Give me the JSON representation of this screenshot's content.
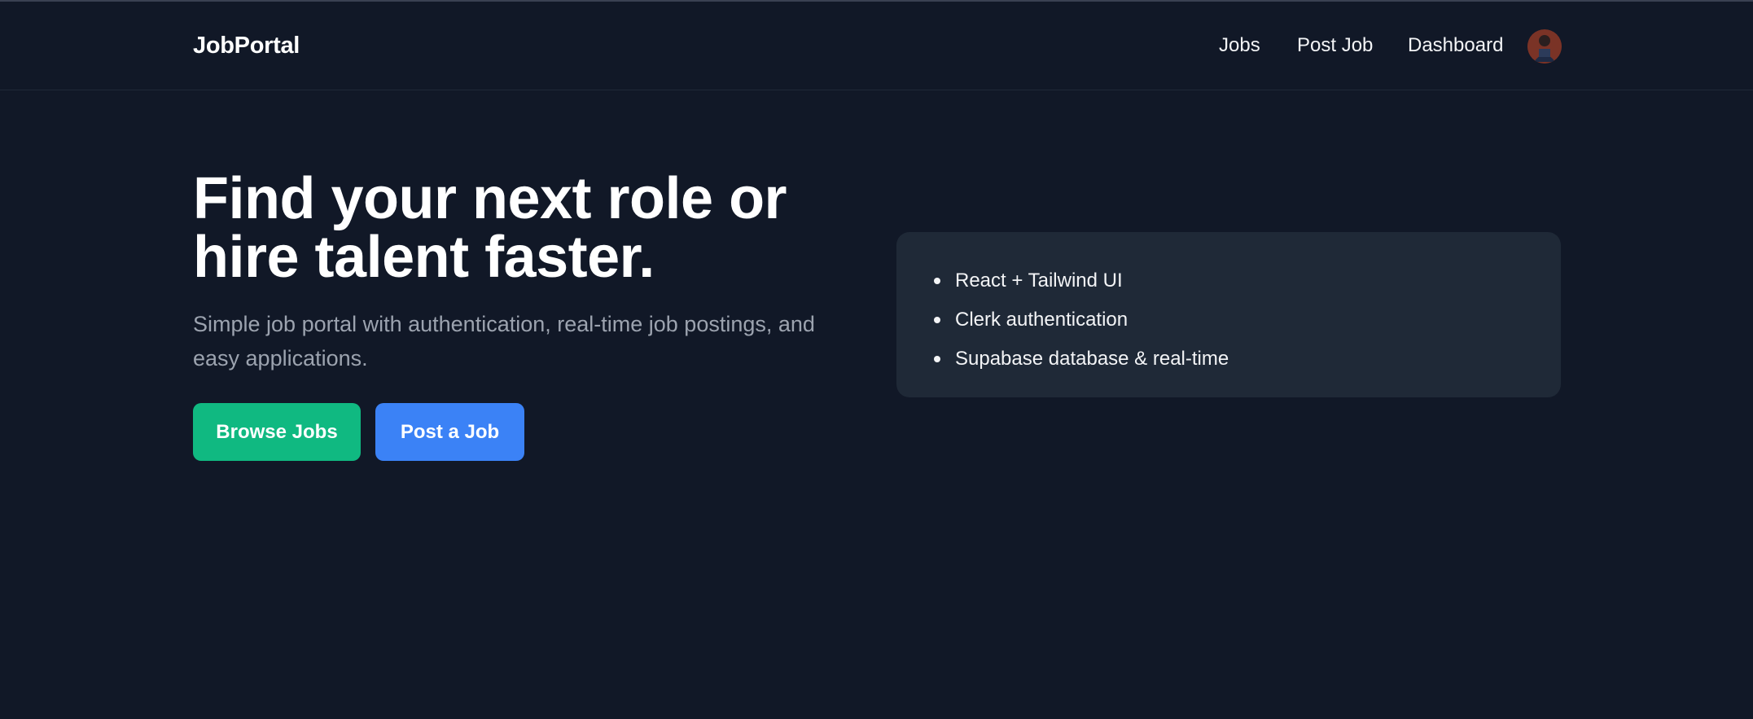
{
  "header": {
    "brand": "JobPortal",
    "nav": [
      {
        "label": "Jobs"
      },
      {
        "label": "Post Job"
      },
      {
        "label": "Dashboard"
      }
    ],
    "avatar_icon": "user-avatar"
  },
  "hero": {
    "title_line1": "Find your next role or",
    "title_line2": "hire talent faster.",
    "subtitle": "Simple job portal with authentication, real-time job postings, and easy applications.",
    "browse_label": "Browse Jobs",
    "post_label": "Post a Job"
  },
  "features": {
    "items": [
      {
        "label": "React + Tailwind UI"
      },
      {
        "label": "Clerk authentication"
      },
      {
        "label": "Supabase database & real-time"
      }
    ]
  },
  "colors": {
    "background": "#111827",
    "card": "#1f2937",
    "browse_button": "#10b981",
    "post_button": "#3b82f6",
    "subtitle": "#9ca3af"
  }
}
